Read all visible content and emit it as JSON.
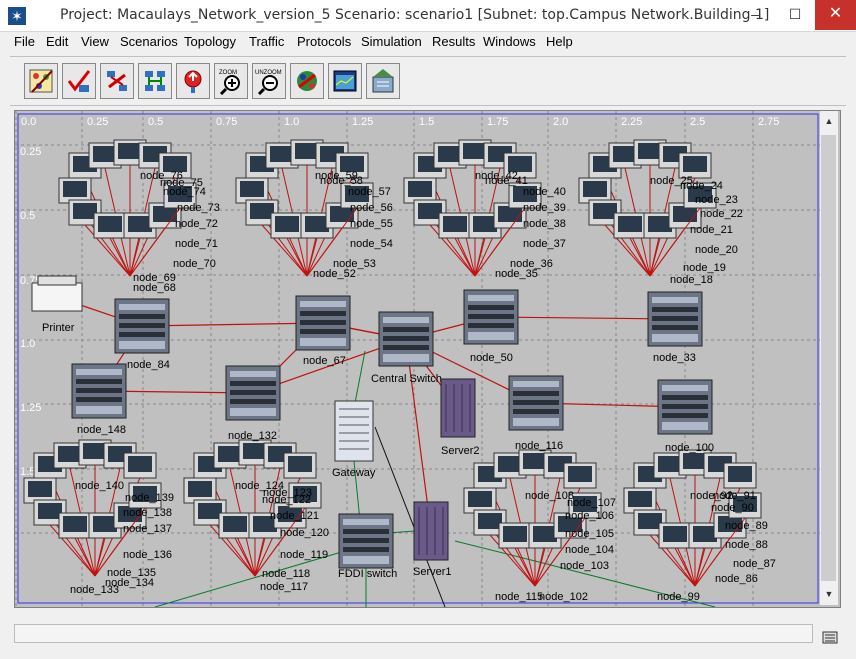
{
  "window": {
    "title": "Project: Macaulays_Network_version_5 Scenario: scenario1  [Subnet: top.Campus Network.Building 1]",
    "minimize": "–",
    "maximize": "☐",
    "close": "✕"
  },
  "menu": [
    "File",
    "Edit",
    "View",
    "Scenarios",
    "Topology",
    "Traffic",
    "Protocols",
    "Simulation",
    "Results",
    "Windows",
    "Help"
  ],
  "toolbar": {
    "buttons": [
      "object-palette-icon",
      "verify-links-icon",
      "failure-icon",
      "recover-icon",
      "configure-icon",
      "zoom-icon",
      "unzoom-icon",
      "run-simulation-icon",
      "view-results-icon",
      "web-report-icon"
    ],
    "zoom_label": "ZOOM",
    "unzoom_label": "UNZOOM"
  },
  "canvas": {
    "x_ruler": [
      "0.0",
      "0.25",
      "0.5",
      "0.75",
      "1.0",
      "1.25",
      "1.5",
      "1.75",
      "2.0",
      "2.25",
      "2.5",
      "2.75"
    ],
    "y_ruler": [
      "0.25",
      "0.5",
      "0.75",
      "1.0",
      "1.25",
      "1.5"
    ],
    "nodes": {
      "printer": "Printer",
      "node_84": "node_84",
      "node_67": "node_67",
      "central_switch": "Central Switch",
      "node_50": "node_50",
      "node_33": "node_33",
      "node_148": "node_148",
      "node_132": "node_132",
      "gateway": "Gateway",
      "server2": "Server2",
      "node_116": "node_116",
      "node_100": "node_100",
      "fddi_switch": "FDDI switch",
      "server1": "Server1"
    },
    "cluster_labels": {
      "c1": [
        "node_76",
        "node_75",
        "node_74",
        "node_73",
        "node_72",
        "node_71",
        "node_70",
        "node_69",
        "node_68"
      ],
      "c2": [
        "node_59",
        "node_58",
        "node_57",
        "node_56",
        "node_55",
        "node_54",
        "node_53",
        "node_52"
      ],
      "c3": [
        "node_42",
        "node_41",
        "node_40",
        "node_39",
        "node_38",
        "node_37",
        "node_36",
        "node_35"
      ],
      "c4": [
        "node_25",
        "node_24",
        "node_23",
        "node_22",
        "node_21",
        "node_20",
        "node_19",
        "node_18"
      ],
      "c5": [
        "node_140",
        "node_139",
        "node_138",
        "node_137",
        "node_136",
        "node_135",
        "node_134",
        "node_133"
      ],
      "c6": [
        "node_124",
        "node_123",
        "node_122",
        "node_121",
        "node_120",
        "node_119",
        "node_118",
        "node_117"
      ],
      "c7": [
        "node_108",
        "node_107",
        "node_106",
        "node_105",
        "node_104",
        "node_103",
        "node_102",
        "node_115"
      ],
      "c8": [
        "node_92",
        "node_91",
        "node_90",
        "node_89",
        "node_88",
        "node_87",
        "node_86",
        "node_99"
      ]
    }
  }
}
